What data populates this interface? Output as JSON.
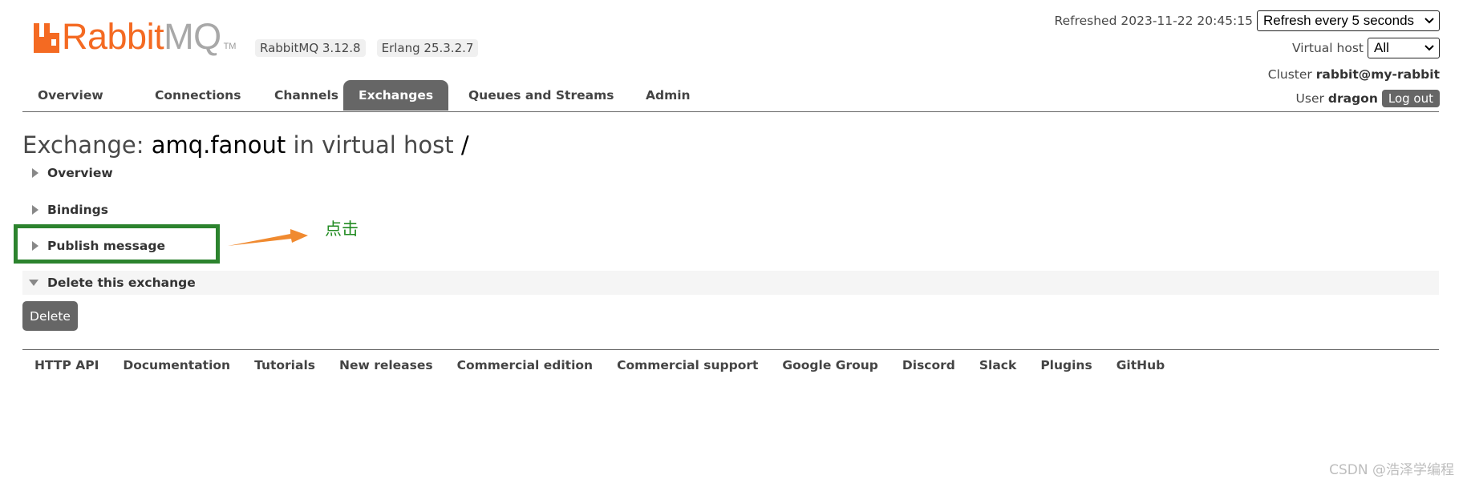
{
  "brand": {
    "name_part1": "Rabbit",
    "name_part2": "MQ",
    "tm": "TM",
    "colors": {
      "orange": "#f46a22",
      "grey": "#a8a8a8"
    }
  },
  "versions": {
    "rabbitmq": "RabbitMQ 3.12.8",
    "erlang": "Erlang 25.3.2.7"
  },
  "header": {
    "refreshed_label": "Refreshed",
    "refreshed_time": "2023-11-22 20:45:15",
    "refresh_option": "Refresh every 5 seconds",
    "vhost_label": "Virtual host",
    "vhost_value": "All",
    "cluster_label": "Cluster",
    "cluster_name": "rabbit@my-rabbit",
    "user_label": "User",
    "user_name": "dragon",
    "logout_label": "Log out"
  },
  "nav": {
    "tabs": [
      {
        "label": "Overview"
      },
      {
        "label": "Connections"
      },
      {
        "label": "Channels"
      },
      {
        "label": "Exchanges",
        "active": true
      },
      {
        "label": "Queues and Streams"
      },
      {
        "label": "Admin"
      }
    ]
  },
  "page": {
    "title_prefix": "Exchange:",
    "exchange_name": "amq.fanout",
    "title_mid": "in virtual host",
    "vhost": "/"
  },
  "sections": {
    "overview": "Overview",
    "bindings": "Bindings",
    "publish": "Publish message",
    "delete": "Delete this exchange"
  },
  "delete_button": "Delete",
  "annotation": {
    "text": "点击",
    "color": "#228b22",
    "box_color": "#2c832e",
    "arrow_color": "#f08a30"
  },
  "footer": {
    "links": [
      "HTTP API",
      "Documentation",
      "Tutorials",
      "New releases",
      "Commercial edition",
      "Commercial support",
      "Google Group",
      "Discord",
      "Slack",
      "Plugins",
      "GitHub"
    ]
  },
  "watermark": "CSDN @浩泽学编程"
}
